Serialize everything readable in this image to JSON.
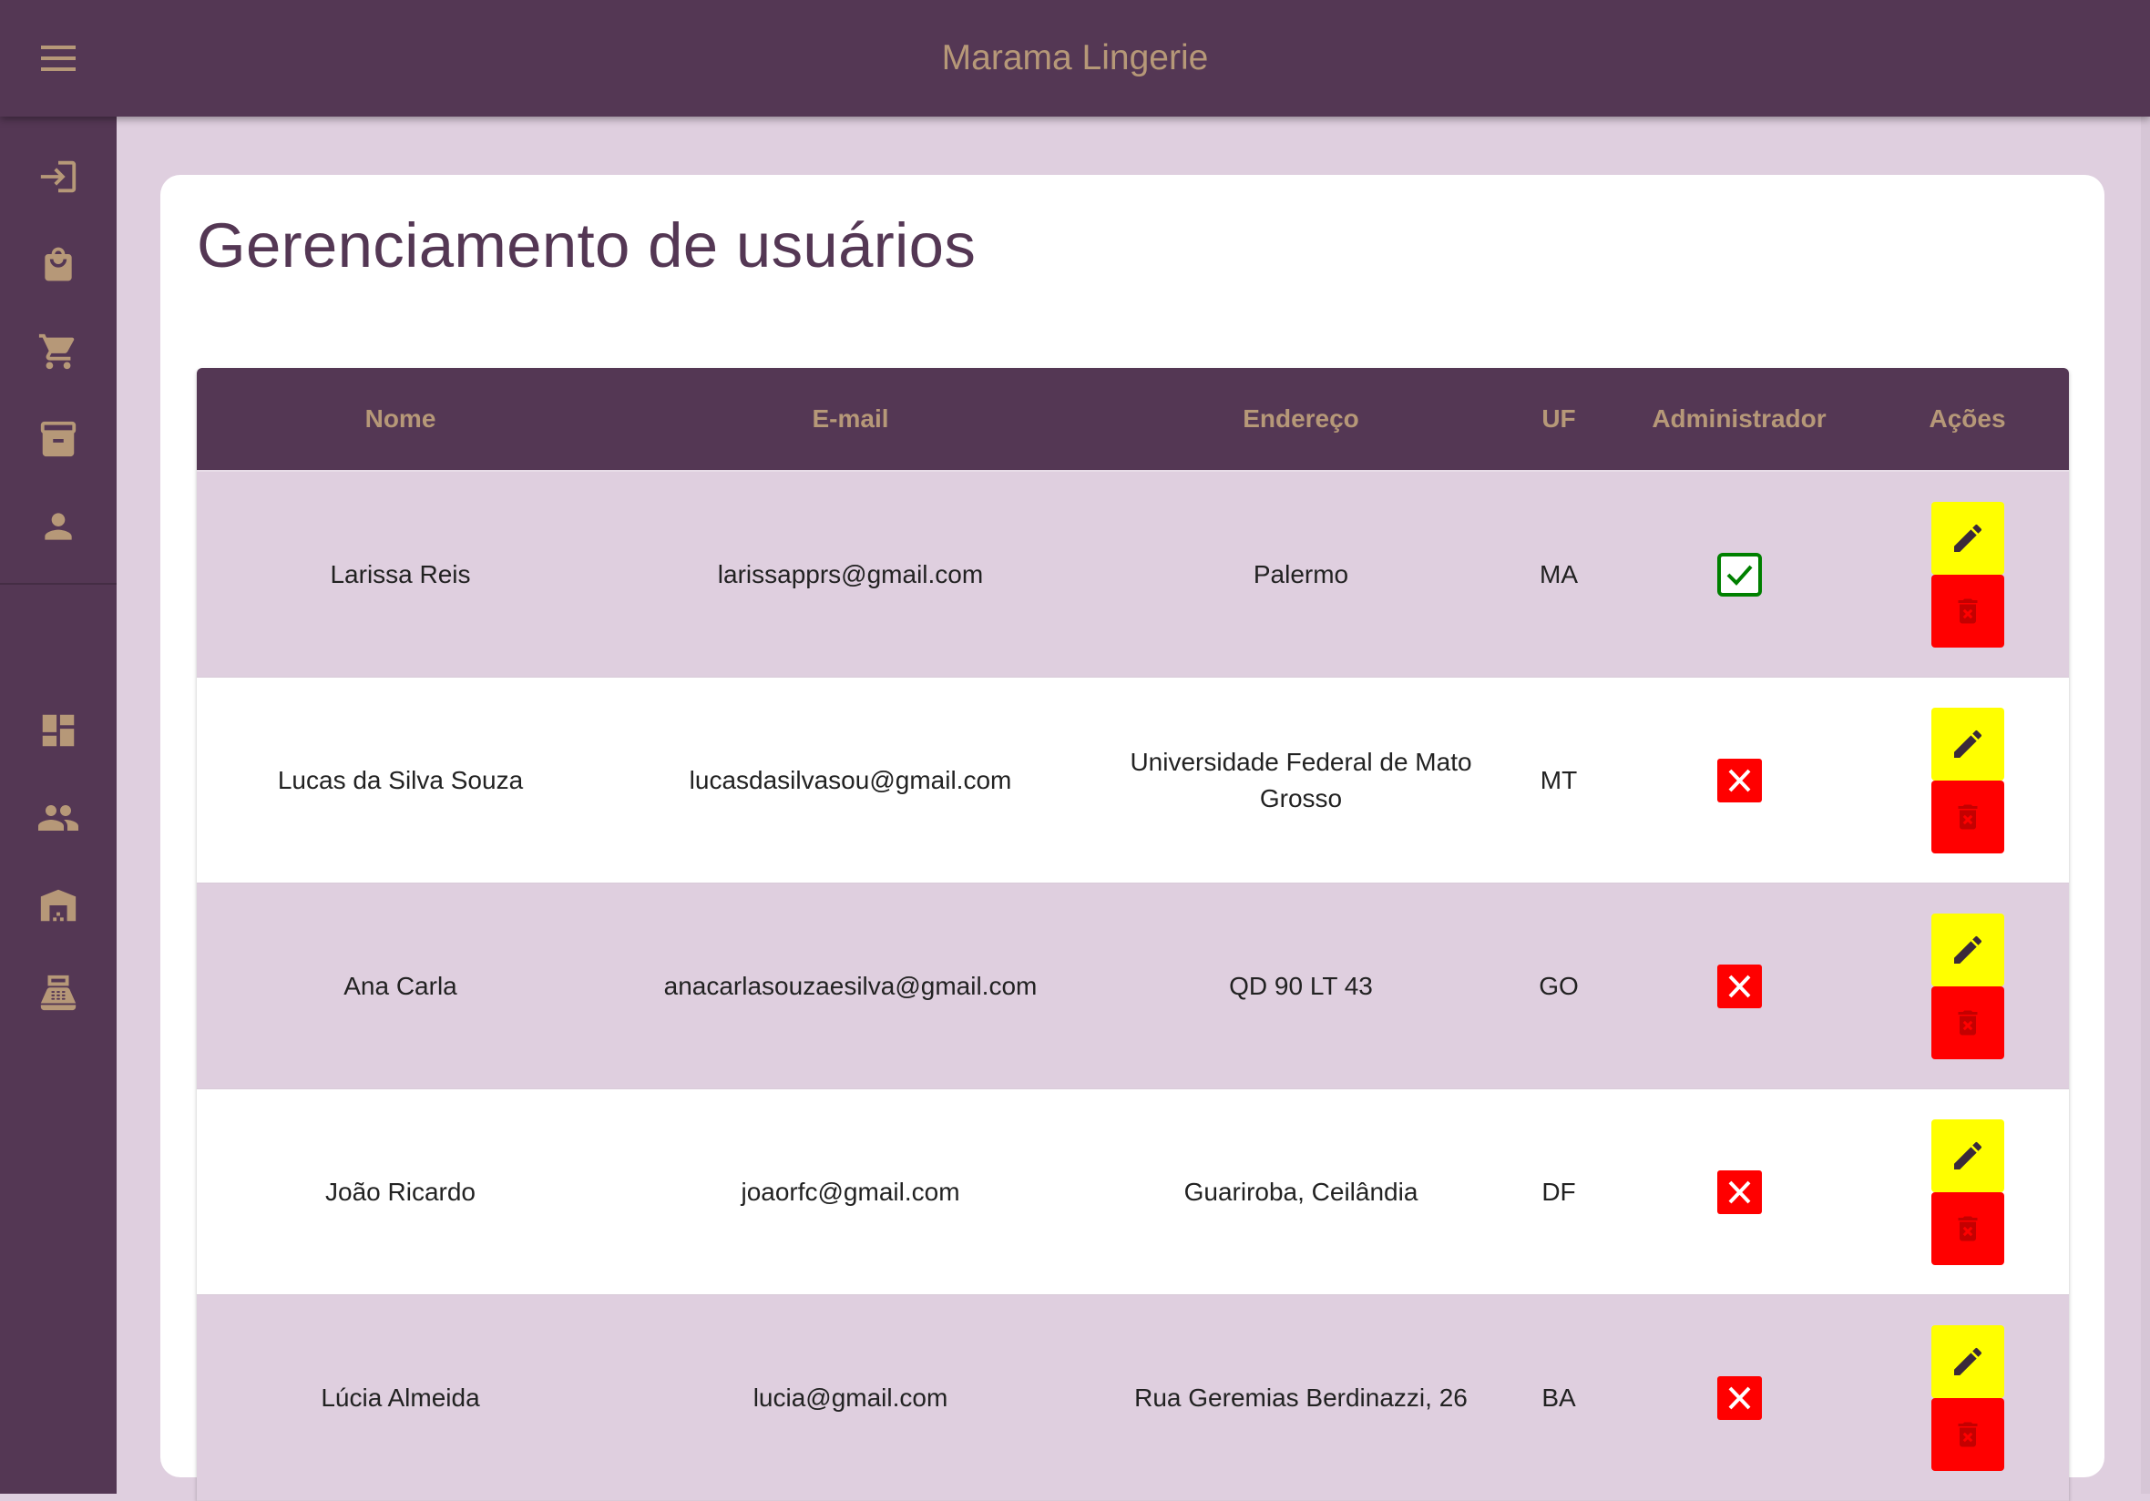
{
  "app": {
    "title": "Marama Lingerie",
    "colors": {
      "primary": "#543754",
      "accent": "#b69878",
      "background": "#dfcfdf",
      "edit": "#ffff00",
      "delete": "#ff0000",
      "admin_yes": "#008000",
      "admin_no": "#ff0000"
    }
  },
  "topbar": {
    "menu_icon": "menu-icon"
  },
  "sidebar": {
    "items": [
      {
        "name": "login-icon"
      },
      {
        "name": "shopping-bag-icon"
      },
      {
        "name": "cart-icon"
      },
      {
        "name": "archive-icon"
      },
      {
        "name": "person-icon"
      },
      {
        "name": "dashboard-icon"
      },
      {
        "name": "people-icon"
      },
      {
        "name": "warehouse-icon"
      },
      {
        "name": "cash-register-icon"
      }
    ]
  },
  "page": {
    "title": "Gerenciamento de usuários",
    "columns": [
      "Nome",
      "E-mail",
      "Endereço",
      "UF",
      "Administrador",
      "Ações"
    ],
    "rows": [
      {
        "nome": "Larissa Reis",
        "email": "larissapprs@gmail.com",
        "endereco": "Palermo",
        "uf": "MA",
        "admin": true
      },
      {
        "nome": "Lucas da Silva Souza",
        "email": "lucasdasilvasou@gmail.com",
        "endereco": "Universidade Federal de Mato Grosso",
        "uf": "MT",
        "admin": false
      },
      {
        "nome": "Ana Carla",
        "email": "anacarlasouzaesilva@gmail.com",
        "endereco": "QD 90 LT 43",
        "uf": "GO",
        "admin": false
      },
      {
        "nome": "João Ricardo",
        "email": "joaorfc@gmail.com",
        "endereco": "Guariroba, Ceilândia",
        "uf": "DF",
        "admin": false
      },
      {
        "nome": "Lúcia Almeida",
        "email": "lucia@gmail.com",
        "endereco": "Rua Geremias Berdinazzi, 26",
        "uf": "BA",
        "admin": false
      }
    ]
  }
}
